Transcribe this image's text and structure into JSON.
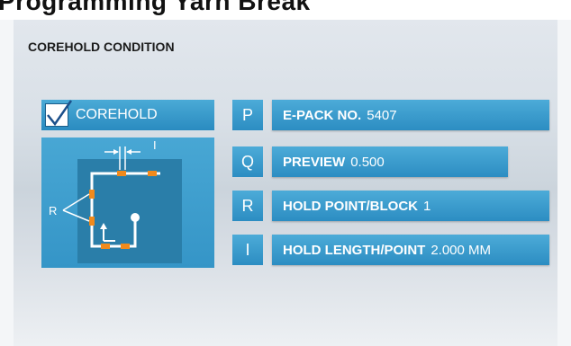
{
  "header": {
    "partial_text": "Programming Yarn Break"
  },
  "section": {
    "title": "COREHOLD CONDITION"
  },
  "corehold": {
    "label": "COREHOLD",
    "checked": true
  },
  "diagram": {
    "label_r": "R",
    "label_i": "I"
  },
  "params": [
    {
      "key": "P",
      "label": "E-PACK NO.",
      "value": "5407"
    },
    {
      "key": "Q",
      "label": "PREVIEW",
      "value": "0.500"
    },
    {
      "key": "R",
      "label": "HOLD POINT/BLOCK",
      "value": "1"
    },
    {
      "key": "I",
      "label": "HOLD LENGTH/POINT",
      "value": "2.000 MM"
    }
  ],
  "colors": {
    "accent": "#2f92c6",
    "diagram_inner": "#2a7ea9",
    "marker": "#f08a1c"
  }
}
